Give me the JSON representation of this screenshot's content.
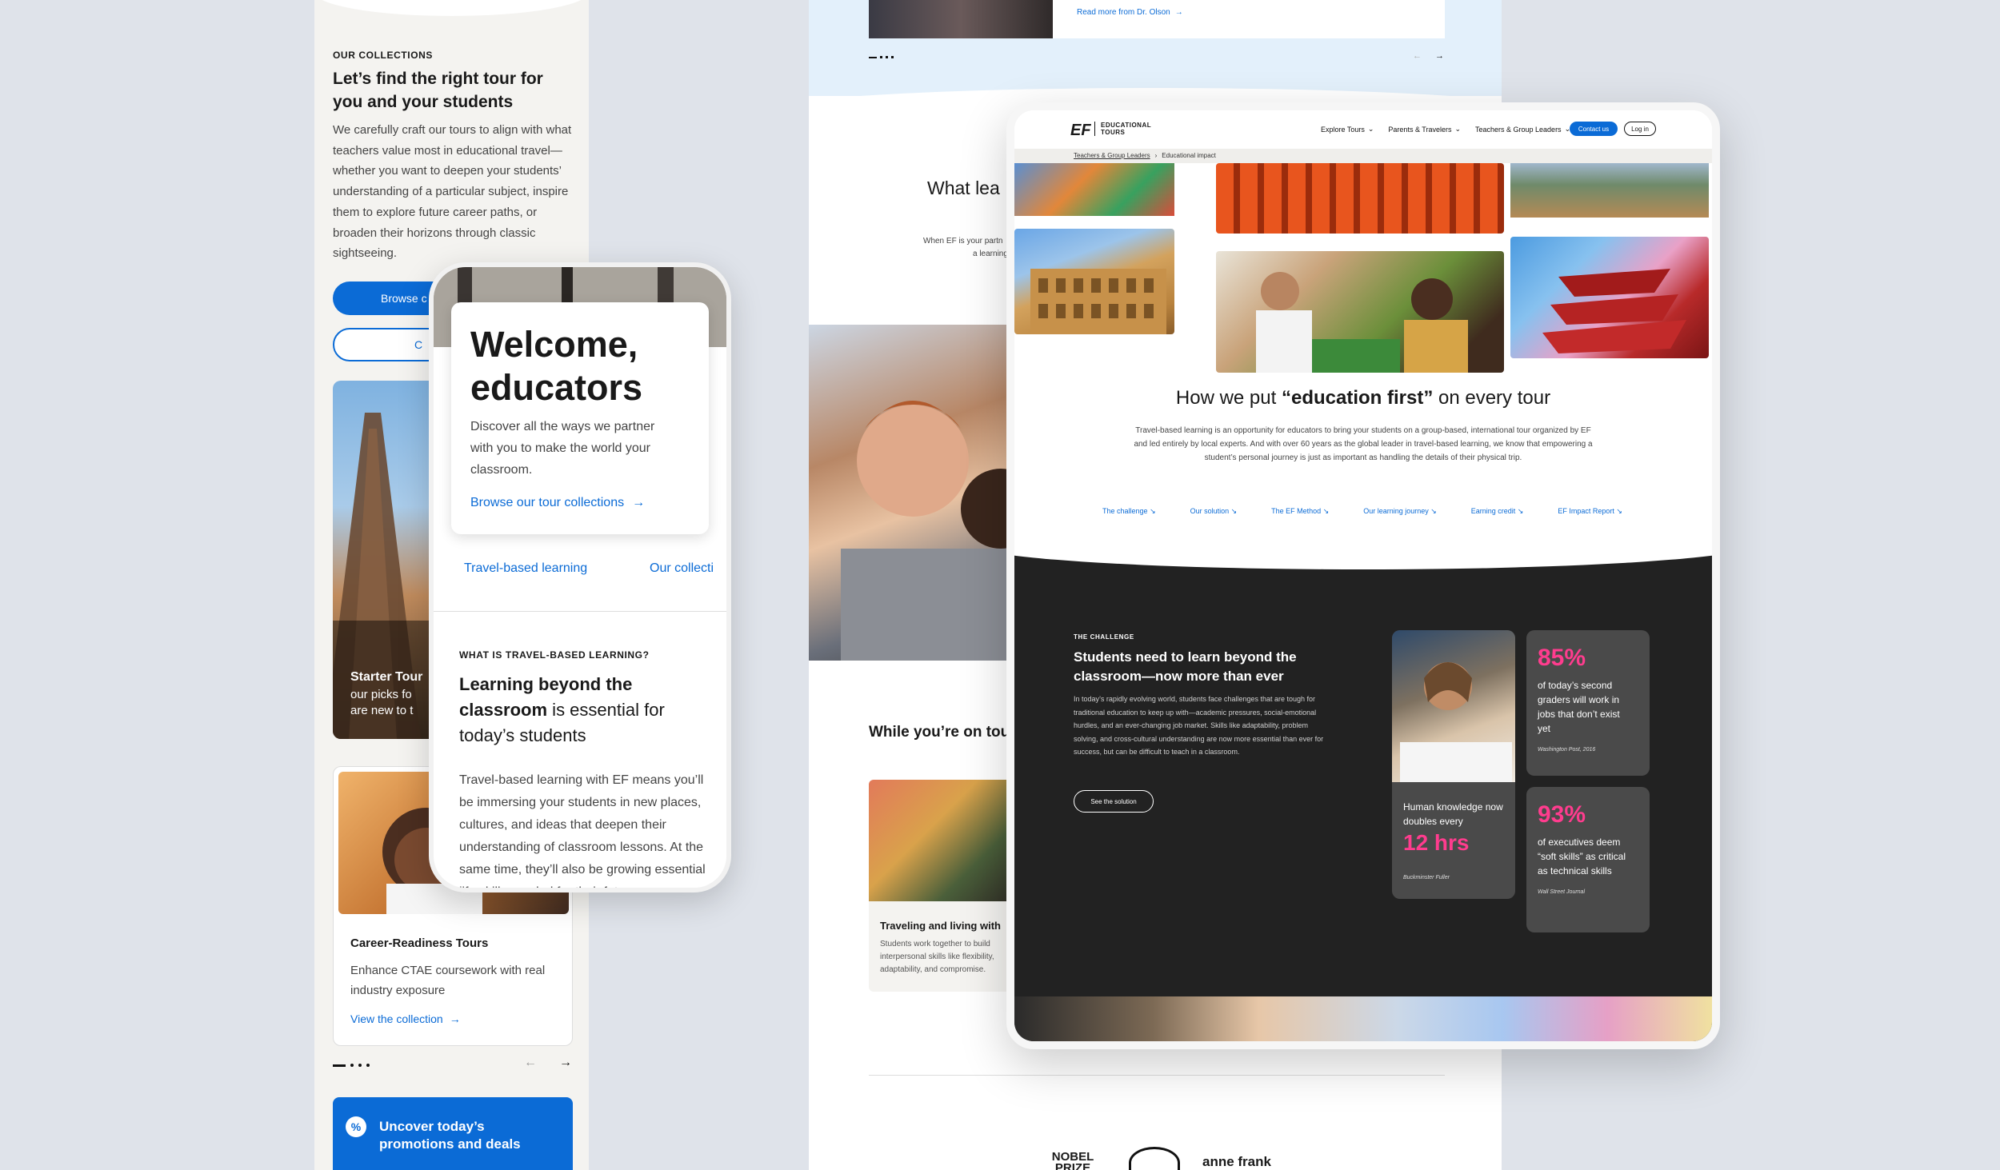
{
  "left": {
    "eyebrow": "OUR COLLECTIONS",
    "heading": "Let’s find the right tour for you and your students",
    "body": "We carefully craft our tours to align with what teachers value most in educational travel—whether you want to deepen your students’ understanding of a particular subject, inspire them to explore future career paths, or broaden their horizons through classic sightseeing.",
    "browse_btn": "Browse c",
    "outline_btn": "C",
    "starter_card": {
      "title": "Starter Tour",
      "text1": "our picks fo",
      "text2": "are new to t"
    },
    "career_card": {
      "title": "Career-Readiness Tours",
      "desc": "Enhance CTAE coursework with real industry exposure",
      "link": "View the collection"
    },
    "promo": "Uncover today’s promotions and deals"
  },
  "phone": {
    "title": "Welcome, educators",
    "text": "Discover all the ways we partner with you to make the world your classroom.",
    "link": "Browse our tour collections",
    "tabs": [
      "Travel-based learning",
      "Our collecti"
    ],
    "eyebrow": "WHAT IS TRAVEL-BASED LEARNING?",
    "heading_bold": "Learning beyond the classroom",
    "heading_rest": " is essential for today’s students",
    "body": "Travel-based learning with EF means you’ll be immersing your students in new places, cultures, and ideas that deepen their understanding of classroom lessons. At the same time, they’ll also be growing essential life skills needed for their futur"
  },
  "center": {
    "read_more": "Read more from Dr. Olson",
    "what_lea": "What lea",
    "ef_partner1": "When EF is your partn",
    "ef_partner2": "a learning",
    "while_on": "While you’re on tou",
    "traveling_title": "Traveling and living with",
    "traveling_desc": "Students work together to build interpersonal skills like flexibility, adaptability, and compromise.",
    "logos": [
      "NOBEL PRIZE",
      "anne frank"
    ]
  },
  "tablet": {
    "logo": "EF",
    "logo_sub1": "EDUCATIONAL",
    "logo_sub2": "TOURS",
    "nav": [
      "Explore Tours",
      "Parents & Travelers",
      "Teachers & Group Leaders"
    ],
    "contact": "Contact us",
    "login": "Log in",
    "breadcrumb": [
      "Teachers & Group Leaders",
      "Educational impact"
    ],
    "headline_pre": "How we put ",
    "headline_bold": "“education first”",
    "headline_post": " on every tour",
    "intro": "Travel-based learning is an opportunity for educators to bring your students on a group-based, international tour organized by EF and led entirely by local experts. And with over 60 years as the global leader in travel-based learning, we know that empowering a student’s personal journey is just as important as handling the details of their physical trip.",
    "jump_links": [
      "The challenge",
      "Our solution",
      "The EF Method",
      "Our learning journey",
      "Earning credit",
      "EF Impact Report"
    ],
    "challenge": {
      "eyebrow": "THE CHALLENGE",
      "heading": "Students need to learn beyond the classroom—now more than ever",
      "body": "In today’s rapidly evolving world, students face challenges that are tough for traditional education to keep up with—academic pressures, social-emotional hurdles, and an ever-changing job market. Skills like adaptability, problem solving, and cross-cultural understanding are now more essential than ever for success, but can be difficult to teach in a classroom.",
      "button": "See the solution"
    },
    "stats": [
      {
        "value": "85%",
        "text": "of today’s second graders will work in jobs that don’t exist yet",
        "source": "Washington Post, 2016"
      },
      {
        "value": "93%",
        "text": "of executives deem “soft skills” as critical as technical skills",
        "source": "Wall Street Journal"
      }
    ],
    "knowledge": {
      "text": "Human knowledge now doubles every",
      "value": "12 hrs",
      "source": "Buckminster Fuller"
    }
  },
  "colors": {
    "accent": "#0b6bd6",
    "pink": "#ff3c8e",
    "dark": "#222222"
  }
}
